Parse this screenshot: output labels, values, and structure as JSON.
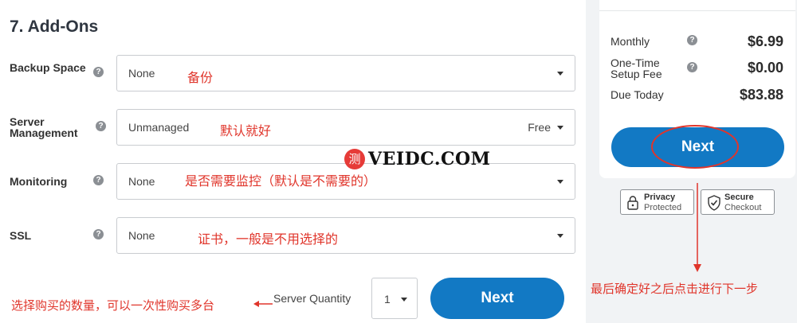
{
  "section": {
    "title": "7. Add-Ons"
  },
  "rows": [
    {
      "label": "Backup Space",
      "value": "None",
      "price": "",
      "annotation": "备份"
    },
    {
      "label": "Server Management",
      "value": "Unmanaged",
      "price": "Free",
      "annotation": "默认就好"
    },
    {
      "label": "Monitoring",
      "value": "None",
      "price": "",
      "annotation": "是否需要监控（默认是不需要的）"
    },
    {
      "label": "SSL",
      "value": "None",
      "price": "",
      "annotation": "证书，一般是不用选择的"
    }
  ],
  "quantity": {
    "label": "Server Quantity",
    "value": "1",
    "annotation": "选择购买的数量，可以一次性购买多台"
  },
  "next_label": "Next",
  "summary": {
    "monthly_label": "Monthly",
    "monthly_value": "$6.99",
    "setup_label": "One-Time Setup Fee",
    "setup_value": "$0.00",
    "due_label": "Due Today",
    "due_value": "$83.88",
    "next_label": "Next",
    "annotation": "最后确定好之后点击进行下一步"
  },
  "badges": {
    "privacy_title": "Privacy",
    "privacy_sub": "Protected",
    "secure_title": "Secure",
    "secure_sub": "Checkout"
  },
  "watermark": {
    "logo": "测",
    "text": "VEIDC.COM"
  },
  "colors": {
    "accent": "#1279c4",
    "annotation": "#e0352b"
  }
}
